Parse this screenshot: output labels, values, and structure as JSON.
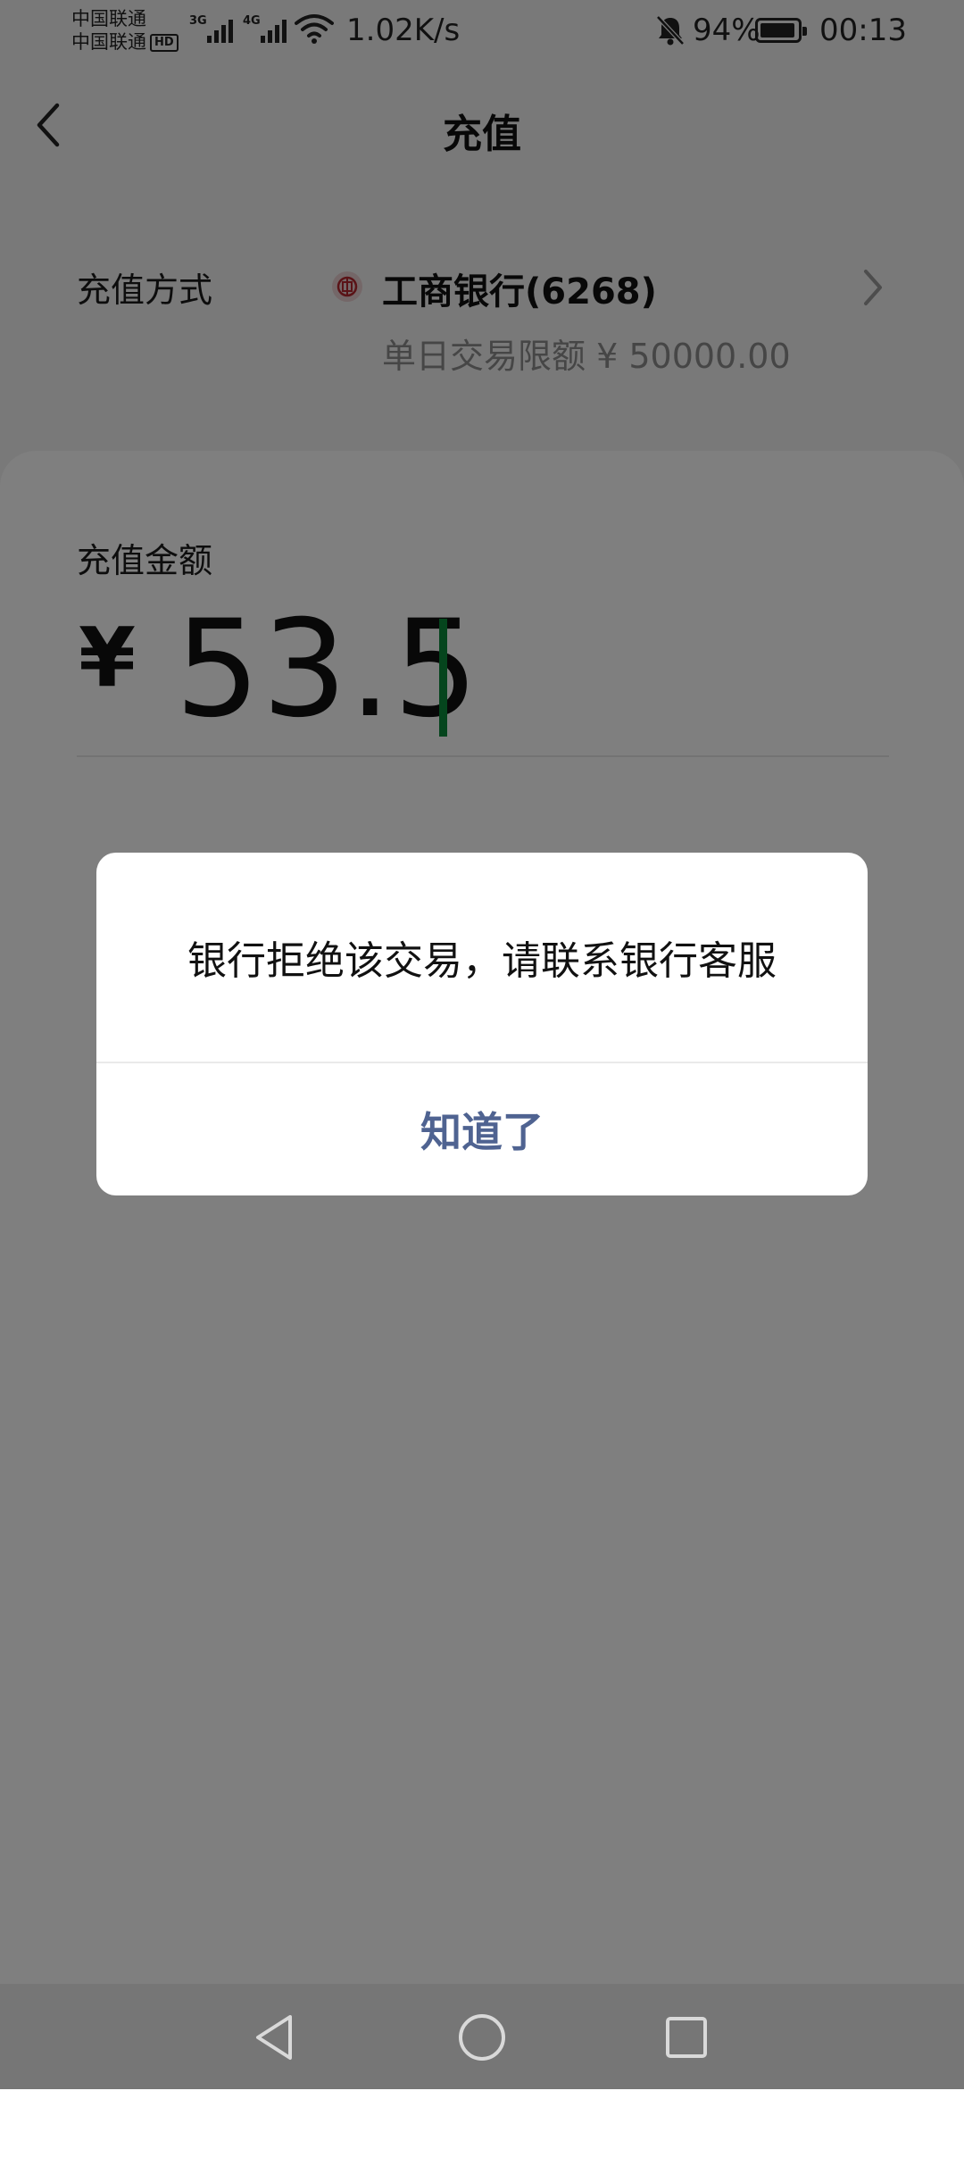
{
  "status_bar": {
    "carrier_1": "中国联通",
    "carrier_2": "中国联通",
    "hd_badge": "HD",
    "signal_1_label": "3G",
    "signal_2_label": "4G",
    "net_speed": "1.02K/s",
    "battery_percent": "94%",
    "time": "00:13",
    "icons": [
      "signal-icon",
      "wifi-icon",
      "bell-off-icon",
      "battery-icon"
    ]
  },
  "header": {
    "title": "充值",
    "back_icon": "chevron-left-icon"
  },
  "payment_method": {
    "label": "充值方式",
    "bank_name": "工商银行(6268)",
    "limit": "单日交易限额 ¥ 50000.00",
    "logo_icon": "icbc-logo-icon",
    "chevron_icon": "chevron-right-icon"
  },
  "amount": {
    "label": "充值金额",
    "currency": "¥",
    "value": "53.5"
  },
  "dialog": {
    "message": "银行拒绝该交易，请联系银行客服",
    "confirm_label": "知道了"
  },
  "system_nav": {
    "icons": [
      "back-triangle-icon",
      "home-circle-icon",
      "recents-square-icon"
    ]
  },
  "colors": {
    "accent_cursor": "#0a8a3a",
    "dialog_button": "#4f6391",
    "bank_logo": "#b5262e"
  }
}
